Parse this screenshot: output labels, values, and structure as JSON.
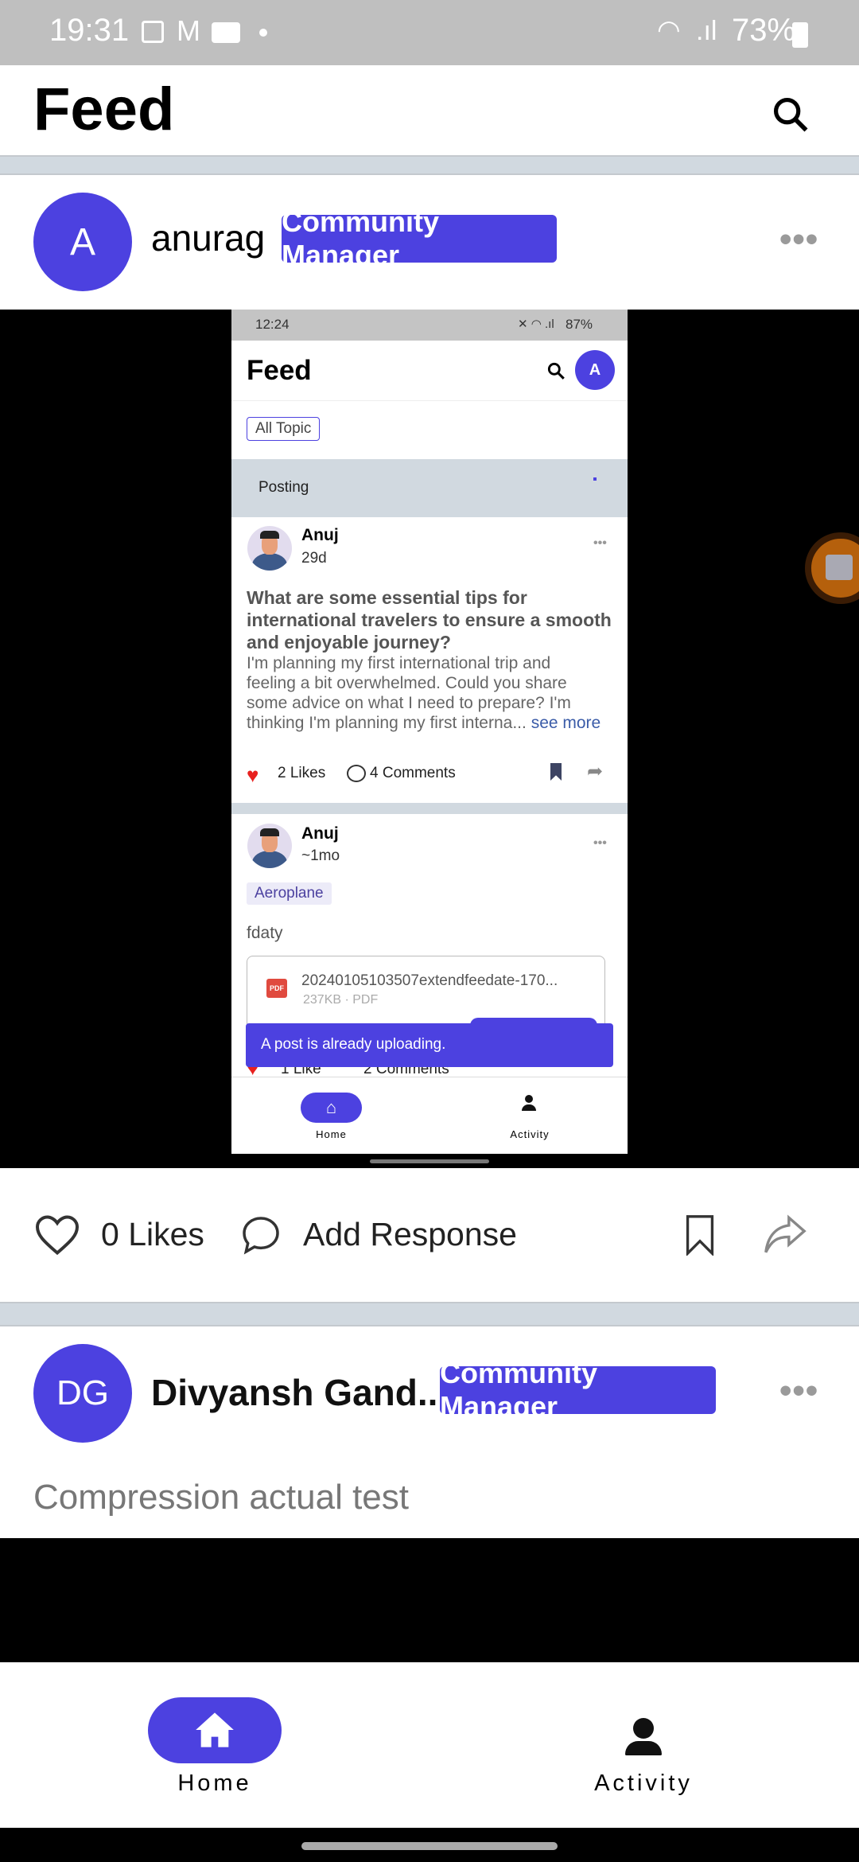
{
  "status_bar": {
    "time": "19:31",
    "battery": "73%",
    "icons": [
      "image-icon",
      "gmail-icon",
      "video-icon",
      "dot-icon",
      "wifi-icon",
      "signal-icon",
      "battery-icon"
    ]
  },
  "header": {
    "title": "Feed",
    "search_icon": "search-icon"
  },
  "posts": [
    {
      "avatar_initials": "A",
      "author": "anurag",
      "badge": "Community Manager",
      "likes": "0 Likes",
      "response": "Add Response"
    },
    {
      "avatar_initials": "DG",
      "author": "Divyansh Gand...",
      "badge": "Community Manager",
      "text": "Compression actual test"
    }
  ],
  "video_content": {
    "status_bar": {
      "time": "12:24",
      "battery": "87%"
    },
    "header": {
      "title": "Feed",
      "avatar": "A"
    },
    "topic_filter": "All Topic",
    "posting_label": "Posting",
    "posts": [
      {
        "author": "Anuj",
        "time": "29d",
        "title_lines": [
          "What are some essential tips for",
          "international travelers to ensure a smooth",
          "and enjoyable journey?"
        ],
        "body_lines": [
          "I'm planning my first international trip and",
          "feeling a bit overwhelmed. Could you share",
          "some advice on what I need to prepare? I'm",
          "thinking I'm planning my first interna..."
        ],
        "see_more": "see more",
        "likes": "2 Likes",
        "comments": "4 Comments"
      },
      {
        "author": "Anuj",
        "time": "~1mo",
        "topic": "Aeroplane",
        "text": "fdaty",
        "attachment_name": "20240105103507extendfeedate-170...",
        "attachment_meta": "237KB · PDF",
        "likes": "1 Like",
        "comments": "2 Comments"
      }
    ],
    "toast": "A post is already uploading.",
    "nav": {
      "home": "Home",
      "activity": "Activity"
    }
  },
  "bottom_nav": {
    "home": "Home",
    "activity": "Activity"
  },
  "colors": {
    "accent": "#4c41e0",
    "band": "#d1d9e0",
    "like": "#e8211f"
  }
}
